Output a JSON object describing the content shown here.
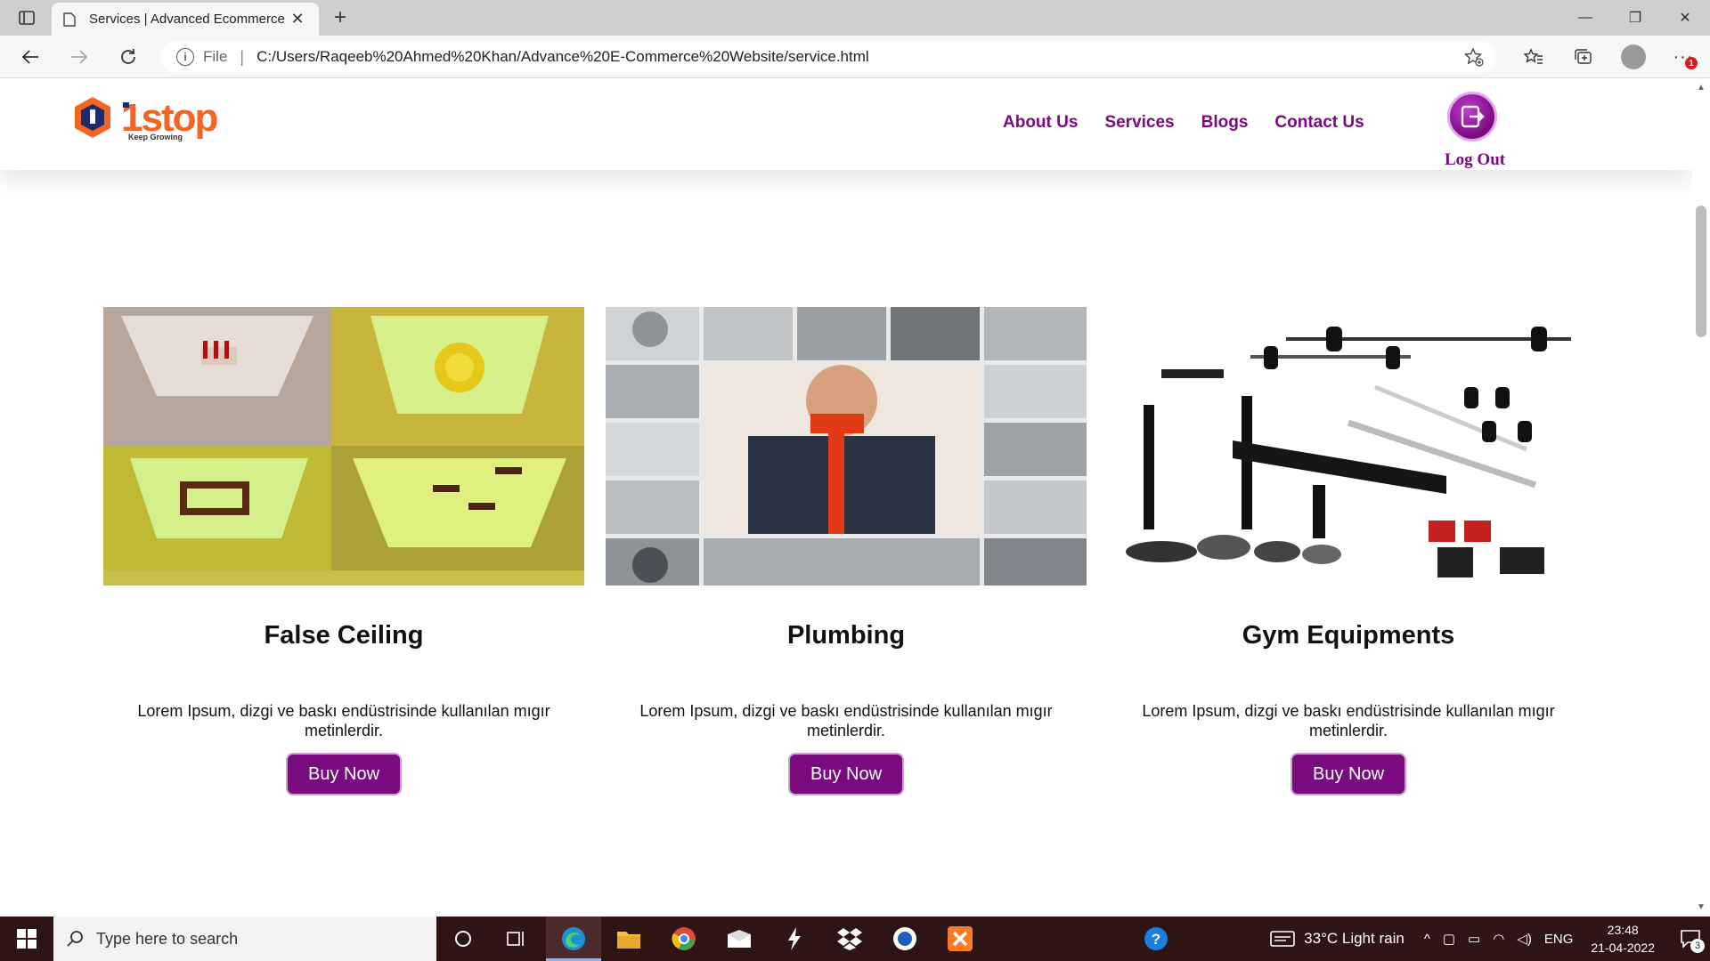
{
  "browser": {
    "tab_title": "Services | Advanced Ecommerce",
    "address_scheme": "File",
    "url": "C:/Users/Raqeeb%20Ahmed%20Khan/Advance%20E-Commerce%20Website/service.html",
    "notification_badge": "1"
  },
  "site": {
    "logo_text": "1stop",
    "logo_tagline": "Keep Growing",
    "menu": [
      {
        "label": "About Us"
      },
      {
        "label": "Services"
      },
      {
        "label": "Blogs"
      },
      {
        "label": "Contact Us"
      }
    ],
    "logout_label": "Log Out"
  },
  "services": [
    {
      "title": "False Ceiling",
      "description": "Lorem Ipsum, dizgi ve baskı endüstrisinde kullanılan mıgır metinlerdir.",
      "button": "Buy Now"
    },
    {
      "title": "Plumbing",
      "description": "Lorem Ipsum, dizgi ve baskı endüstrisinde kullanılan mıgır metinlerdir.",
      "button": "Buy Now"
    },
    {
      "title": "Gym Equipments",
      "description": "Lorem Ipsum, dizgi ve baskı endüstrisinde kullanılan mıgır metinlerdir.",
      "button": "Buy Now"
    }
  ],
  "taskbar": {
    "search_placeholder": "Type here to search",
    "weather": "33°C  Light rain",
    "language": "ENG",
    "time": "23:48",
    "date": "21-04-2022",
    "notification_count": "3"
  },
  "colors": {
    "brand_purple": "#7a0a80",
    "logo_orange": "#f26522",
    "taskbar": "#2e1414"
  }
}
